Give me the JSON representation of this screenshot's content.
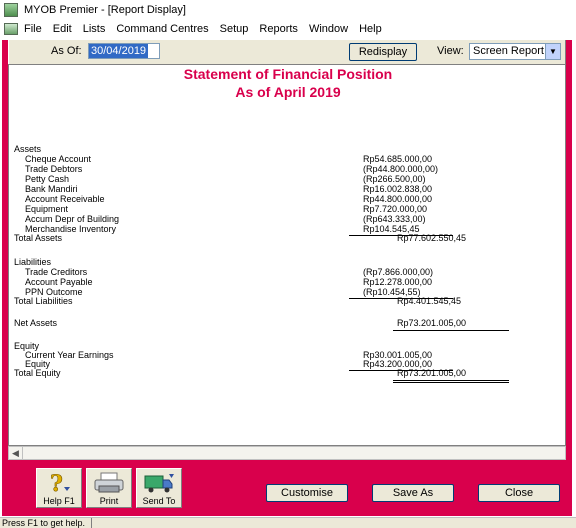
{
  "window": {
    "title": "MYOB Premier - [Report Display]"
  },
  "menu": [
    "File",
    "Edit",
    "Lists",
    "Command Centres",
    "Setup",
    "Reports",
    "Window",
    "Help"
  ],
  "toolbar": {
    "asof_label": "As Of:",
    "asof_value": "30/04/2019",
    "redisplay_label": "Redisplay",
    "view_label": "View:",
    "view_value": "Screen Report"
  },
  "report": {
    "title": "Statement of Financial Position",
    "subtitle": "As of April 2019",
    "assets": {
      "heading": "Assets",
      "items": [
        {
          "label": "Cheque Account",
          "amount": "Rp54.685.000,00"
        },
        {
          "label": "Trade Debtors",
          "amount": "(Rp44.800.000,00)"
        },
        {
          "label": "Petty Cash",
          "amount": "(Rp266.500,00)"
        },
        {
          "label": "Bank Mandiri",
          "amount": "Rp16.002.838,00"
        },
        {
          "label": "Account Receivable",
          "amount": "Rp44.800.000,00"
        },
        {
          "label": "Equipment",
          "amount": "Rp7.720.000,00"
        },
        {
          "label": "Accum Depr of Building",
          "amount": "(Rp643.333,00)"
        },
        {
          "label": "Merchandise Inventory",
          "amount": "Rp104.545,45"
        }
      ],
      "total_label": "Total Assets",
      "total_amount": "Rp77.602.550,45"
    },
    "liabilities": {
      "heading": "Liabilities",
      "items": [
        {
          "label": "Trade Creditors",
          "amount": "(Rp7.866.000,00)"
        },
        {
          "label": "Account Payable",
          "amount": "Rp12.278.000,00"
        },
        {
          "label": "PPN Outcome",
          "amount": "(Rp10.454,55)"
        }
      ],
      "total_label": "Total Liabilities",
      "total_amount": "Rp4.401.545,45"
    },
    "net_assets": {
      "label": "Net Assets",
      "amount": "Rp73.201.005,00"
    },
    "equity": {
      "heading": "Equity",
      "items": [
        {
          "label": "Current Year Earnings",
          "amount": "Rp30.001.005,00"
        },
        {
          "label": "Equity",
          "amount": "Rp43.200.000,00"
        }
      ],
      "total_label": "Total Equity",
      "total_amount": "Rp73.201.005,00"
    }
  },
  "bottom": {
    "help_label": "Help F1",
    "print_label": "Print",
    "sendto_label": "Send To",
    "customise_label": "Customise",
    "saveas_label": "Save As",
    "close_label": "Close"
  },
  "status": {
    "text": "Press F1 to get help."
  },
  "colors": {
    "accent": "#d9004c",
    "title": "#d9004c",
    "selection": "#316ac5"
  }
}
